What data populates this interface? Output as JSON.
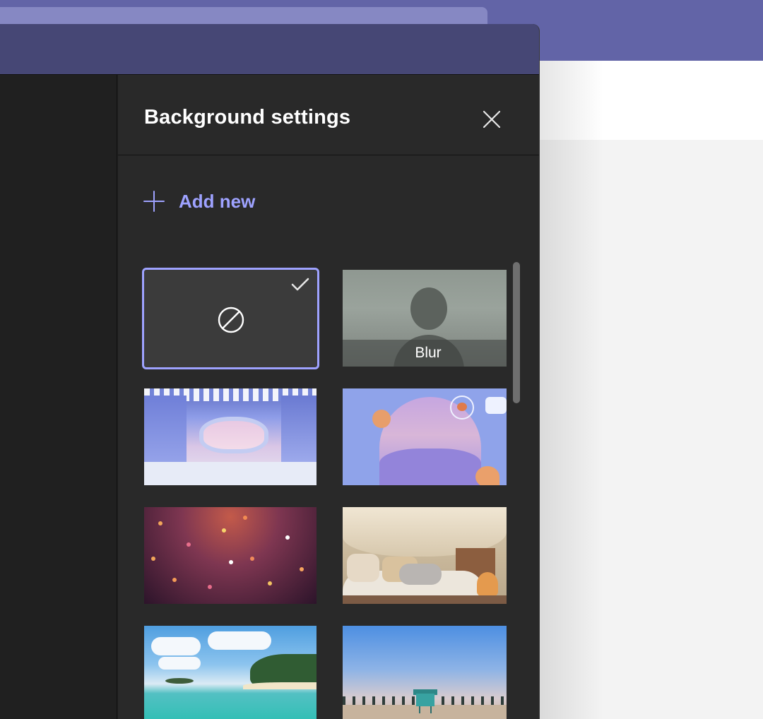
{
  "panel": {
    "title": "Background settings",
    "close_icon": "close-icon",
    "add_new_label": "Add new",
    "add_new_icon": "plus-icon"
  },
  "backgrounds": [
    {
      "id": "none",
      "label": "",
      "selected": true,
      "icon": "no-background-icon"
    },
    {
      "id": "blur",
      "label": "Blur",
      "selected": false
    },
    {
      "id": "ice-cave",
      "label": "",
      "selected": false
    },
    {
      "id": "winter-arch",
      "label": "",
      "selected": false
    },
    {
      "id": "confetti",
      "label": "",
      "selected": false
    },
    {
      "id": "blanket-fort",
      "label": "",
      "selected": false
    },
    {
      "id": "tropical-beach",
      "label": "",
      "selected": false
    },
    {
      "id": "lifeguard-shore",
      "label": "",
      "selected": false
    }
  ],
  "colors": {
    "accent": "#9ea2ff",
    "panel_bg": "#292929",
    "titlebar": "#464775",
    "host_topbar": "#6264a7"
  }
}
